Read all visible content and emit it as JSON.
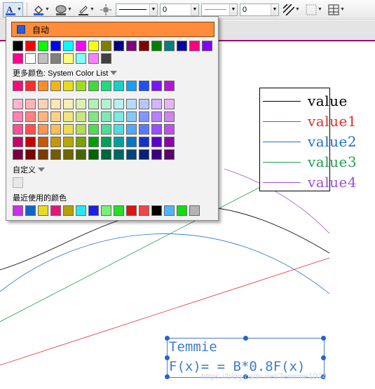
{
  "toolbar": {
    "icons": [
      "font-color-icon",
      "fill-color-icon",
      "fill-effect-icon",
      "line-color-icon",
      "brightness-icon",
      "line-style-icon",
      "pattern-fill-icon",
      "border-icon",
      "table-icon"
    ],
    "line_style_preview": "solid",
    "line_width_value": "0",
    "line_width2_value": "0"
  },
  "picker": {
    "auto_label": "自动",
    "auto_color": "#2a5ed8",
    "highlight_color": "#ff8c3a",
    "more_colors_label": "更多颜色: System Color List",
    "custom_label": "自定义",
    "recent_label": "最近使用的颜色",
    "standard_row1": [
      "#000000",
      "#ff0000",
      "#00ff00",
      "#0000ff",
      "#00ffff",
      "#ff00ff",
      "#ffff00",
      "#808000",
      "#000080",
      "#800080",
      "#800000",
      "#008000",
      "#008080",
      "#0000a0",
      "#ff0080",
      "#8000ff"
    ],
    "standard_row2": [
      "#ff0090",
      "#ffffff",
      "#c0c0c0",
      "#808080",
      "#ffff80",
      "#80ffff",
      "#ff80ff",
      "#404040"
    ],
    "system_row": [
      "#ff0a78",
      "#ff2d2d",
      "#ff8c28",
      "#f5b414",
      "#e6dc1e",
      "#a0dc1e",
      "#3cdc3c",
      "#1edc82",
      "#14d2c8",
      "#14a0ff",
      "#1e50ff",
      "#7814ff",
      "#b414dc"
    ],
    "tints": [
      [
        "#ffb4d2",
        "#ffb4b4",
        "#ffd2b4",
        "#ffe6b4",
        "#f5f0b4",
        "#dcf0b4",
        "#b4f0b4",
        "#b4f0d2",
        "#b4f0f0",
        "#b4dcff",
        "#b4c8ff",
        "#d2b4ff",
        "#e6b4f5"
      ],
      [
        "#ff82b4",
        "#ff8282",
        "#ffb482",
        "#ffd282",
        "#f0e682",
        "#c8e682",
        "#82e682",
        "#82e6b4",
        "#82e6e6",
        "#82c8ff",
        "#8296ff",
        "#b482ff",
        "#d282f0"
      ],
      [
        "#ff5096",
        "#ff5050",
        "#ff9650",
        "#ffbe50",
        "#ebdc50",
        "#b4dc50",
        "#50dc50",
        "#50dc96",
        "#50dcdc",
        "#50aaff",
        "#5a78ff",
        "#9650ff",
        "#be50eb"
      ],
      [
        "#c80064",
        "#c80000",
        "#c85a00",
        "#c89600",
        "#b4aa00",
        "#78a000",
        "#00a000",
        "#00a05a",
        "#00a0a0",
        "#0078c8",
        "#1432c8",
        "#5a00c8",
        "#8c00b4"
      ],
      [
        "#780040",
        "#780000",
        "#783c00",
        "#785a00",
        "#6e6400",
        "#466400",
        "#006400",
        "#00643c",
        "#006464",
        "#004678",
        "#0a1e78",
        "#3c0078",
        "#5a0070"
      ]
    ],
    "recent": [
      "#c832e6",
      "#1464c8",
      "#e6dc28",
      "#e6147a",
      "#b4a000",
      "#28e6f0",
      "#1e1ee6",
      "#78f078",
      "#28dc28",
      "#dc1414",
      "#f04646",
      "#000000",
      "#50b4ff",
      "#14dc14",
      "#b4b4b4"
    ]
  },
  "legend": {
    "items": [
      {
        "label": "value",
        "color": "#000000"
      },
      {
        "label": "value1",
        "color": "#e03030"
      },
      {
        "label": "value2",
        "color": "#2070d0"
      },
      {
        "label": "value3",
        "color": "#20a050"
      },
      {
        "label": "value4",
        "color": "#a050d0"
      }
    ]
  },
  "formula": {
    "line1": "Temmie",
    "line2": "F(x)= = B*0.8F(x)"
  },
  "watermark": "https://blog.csdn.net/Temmie1024"
}
